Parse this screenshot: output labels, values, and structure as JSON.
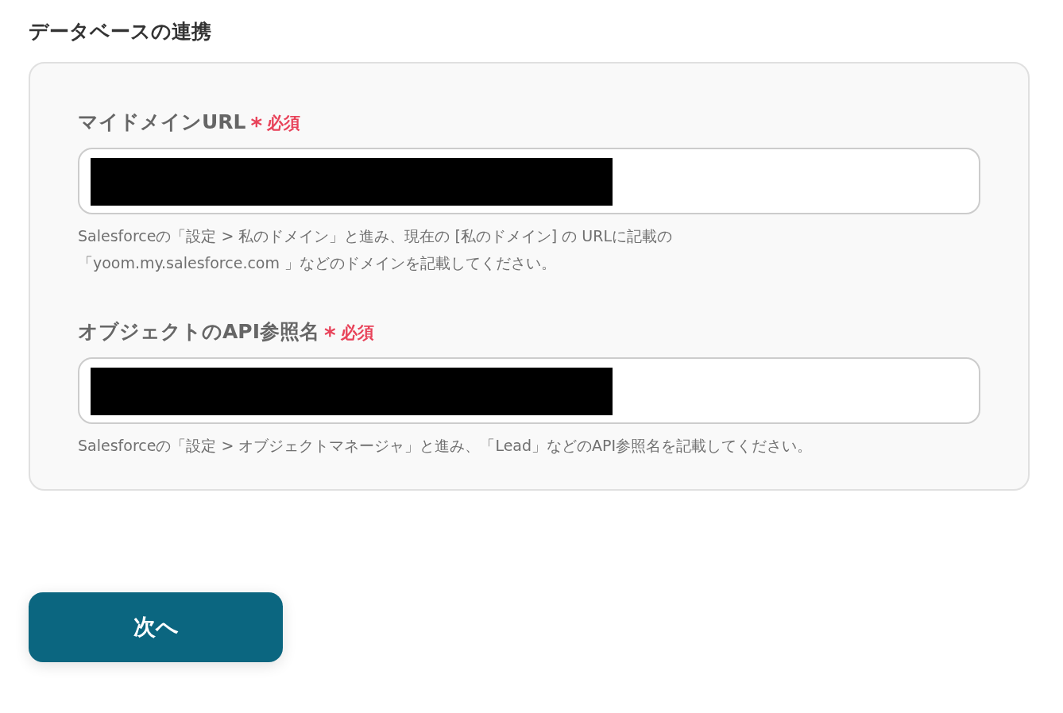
{
  "section_title": "データベースの連携",
  "fields": [
    {
      "label": "マイドメインURL",
      "required_mark": "*",
      "required_text": "必須",
      "redacted": true,
      "help_lines": [
        "Salesforceの「設定 > 私のドメイン」と進み、現在の [私のドメイン] の URLに記載の",
        "「yoom.my.salesforce.com 」などのドメインを記載してください。"
      ]
    },
    {
      "label": "オブジェクトのAPI参照名",
      "required_mark": "*",
      "required_text": "必須",
      "redacted": true,
      "help_lines": [
        "Salesforceの「設定 > オブジェクトマネージャ」と進み、「Lead」などのAPI参照名を記載してください。"
      ]
    }
  ],
  "next_button": "次へ"
}
